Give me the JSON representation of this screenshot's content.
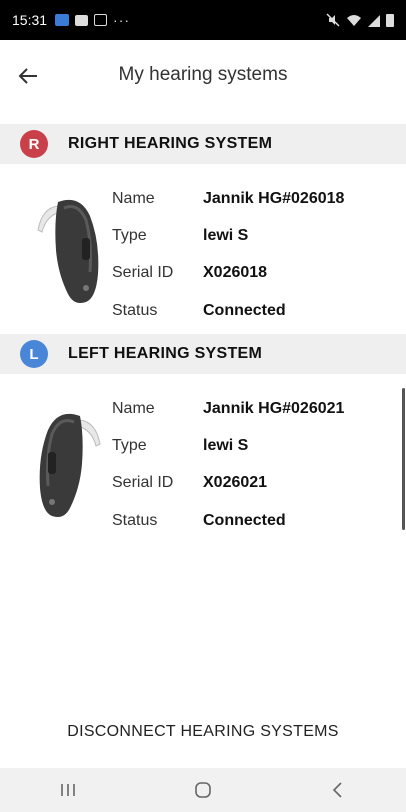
{
  "status_bar": {
    "time": "15:31",
    "icons": [
      "app-icon",
      "message-icon",
      "gallery-icon",
      "more-dots-icon",
      "mute-icon",
      "wifi-icon",
      "signal-icon",
      "battery-icon"
    ]
  },
  "header": {
    "title": "My hearing systems",
    "back_icon": "arrow-left-icon"
  },
  "right_system": {
    "badge": "R",
    "badge_color": "#c9404a",
    "title": "RIGHT HEARING SYSTEM",
    "rows": [
      {
        "label": "Name",
        "value": "Jannik HG#026018"
      },
      {
        "label": "Type",
        "value": "lewi S"
      },
      {
        "label": "Serial ID",
        "value": "X026018"
      },
      {
        "label": "Status",
        "value": "Connected"
      }
    ]
  },
  "left_system": {
    "badge": "L",
    "badge_color": "#4a86d8",
    "title": "LEFT HEARING SYSTEM",
    "rows": [
      {
        "label": "Name",
        "value": "Jannik HG#026021"
      },
      {
        "label": "Type",
        "value": "lewi S"
      },
      {
        "label": "Serial ID",
        "value": "X026021"
      },
      {
        "label": "Status",
        "value": "Connected"
      }
    ]
  },
  "actions": {
    "disconnect_label": "DISCONNECT HEARING SYSTEMS"
  },
  "nav_bar": {
    "icons": [
      "recent-apps-icon",
      "home-icon",
      "back-nav-icon"
    ]
  }
}
